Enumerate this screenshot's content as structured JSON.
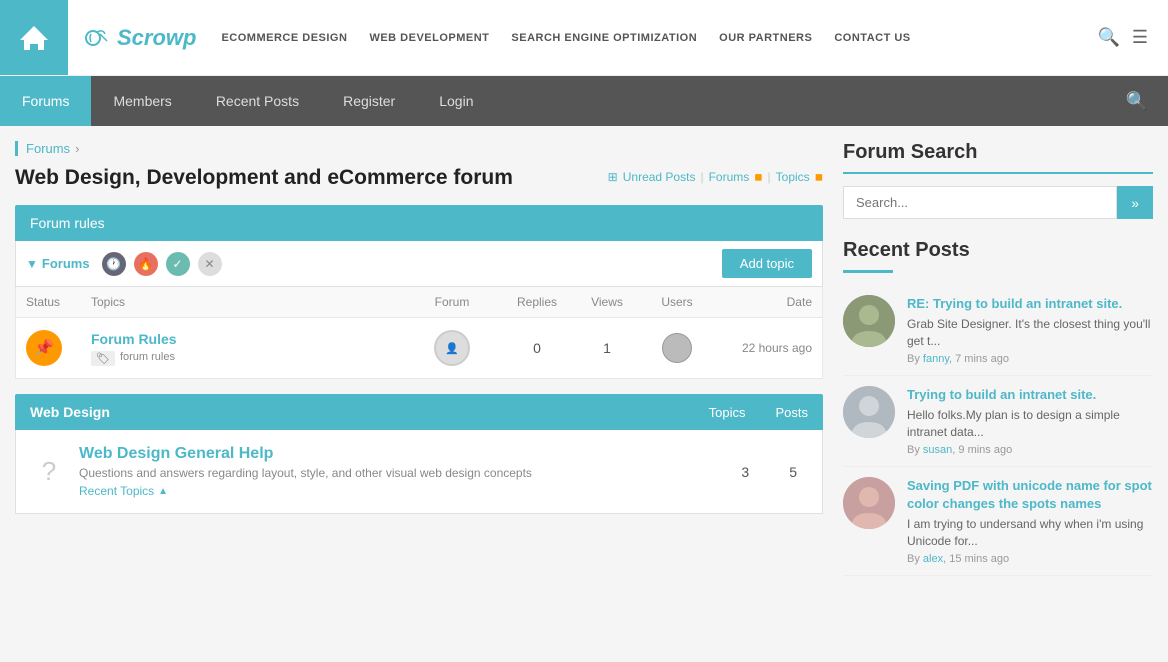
{
  "site": {
    "logo_text": "Scrowp",
    "logo_icon": "✦"
  },
  "top_nav": {
    "links": [
      {
        "label": "ECOMMERCE DESIGN",
        "href": "#"
      },
      {
        "label": "WEB DEVELOPMENT",
        "href": "#"
      },
      {
        "label": "SEARCH ENGINE OPTIMIZATION",
        "href": "#"
      },
      {
        "label": "OUR PARTNERS",
        "href": "#"
      },
      {
        "label": "CONTACT US",
        "href": "#"
      }
    ]
  },
  "sec_nav": {
    "tabs": [
      {
        "label": "Forums",
        "active": true
      },
      {
        "label": "Members",
        "active": false
      },
      {
        "label": "Recent Posts",
        "active": false
      },
      {
        "label": "Register",
        "active": false
      },
      {
        "label": "Login",
        "active": false
      }
    ]
  },
  "breadcrumb": {
    "items": [
      {
        "label": "Forums",
        "href": "#"
      }
    ]
  },
  "page_title": "Web Design, Development and eCommerce forum",
  "title_links": {
    "unread": "Unread Posts",
    "forums": "Forums",
    "topics": "Topics"
  },
  "forum_rules_bar": {
    "label": "Forum rules"
  },
  "forums_filter": {
    "label": "Forums",
    "add_topic": "Add topic"
  },
  "table_headers": {
    "status": "Status",
    "topics": "Topics",
    "forum": "Forum",
    "replies": "Replies",
    "views": "Views",
    "users": "Users",
    "date": "Date"
  },
  "pinned_topic": {
    "title": "Forum Rules",
    "tag": "forum rules",
    "replies": "0",
    "views": "1",
    "date": "22 hours ago"
  },
  "web_design_section": {
    "title": "Web Design",
    "topics_label": "Topics",
    "posts_label": "Posts"
  },
  "web_design_general": {
    "title": "Web Design General Help",
    "desc": "Questions and answers regarding layout, style, and other visual web design concepts",
    "recent_label": "Recent Topics",
    "topics_count": "3",
    "posts_count": "5"
  },
  "sidebar": {
    "forum_search_title": "Forum Search",
    "search_placeholder": "Search...",
    "search_button": "»",
    "recent_posts_title": "Recent Posts",
    "recent_posts": [
      {
        "title": "RE: Trying to build an intranet site.",
        "excerpt": "Grab Site Designer. It's the closest thing you'll get t...",
        "author": "fanny",
        "time": "7 mins ago",
        "avatar_color": "#8b9"
      },
      {
        "title": "Trying to build an intranet site.",
        "excerpt": "Hello folks.My plan is to design a simple intranet data...",
        "author": "susan",
        "time": "9 mins ago",
        "avatar_color": "#bbb"
      },
      {
        "title": "Saving PDF with unicode name for spot color changes the spots names",
        "excerpt": "I am trying to undersand why when i'm using Unicode for...",
        "author": "alex",
        "time": "15 mins ago",
        "avatar_color": "#c9a"
      }
    ]
  }
}
